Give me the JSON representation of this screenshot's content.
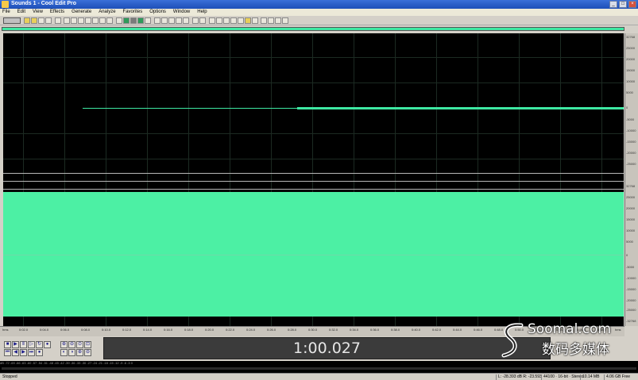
{
  "window": {
    "title": "Sounds 1 - Cool Edit Pro",
    "controls": [
      "_",
      "□",
      "×"
    ]
  },
  "menu": [
    "File",
    "Edit",
    "View",
    "Effects",
    "Generate",
    "Analyze",
    "Favorites",
    "Options",
    "Window",
    "Help"
  ],
  "time_display": "1:00.027",
  "amplitude_ruler": [
    "32768",
    "25000",
    "20000",
    "15000",
    "10000",
    "5000",
    "0",
    "-5000",
    "-10000",
    "-15000",
    "-20000",
    "-25000",
    "32768",
    "25000",
    "20000",
    "15000",
    "10000",
    "5000",
    "0",
    "-5000",
    "-10000",
    "-15000",
    "-20000",
    "-25000",
    "-32768"
  ],
  "time_ruler": [
    "hms",
    "0:02.0",
    "0:04.0",
    "0:06.0",
    "0:08.0",
    "0:10.0",
    "0:12.0",
    "0:14.0",
    "0:16.0",
    "0:18.0",
    "0:20.0",
    "0:22.0",
    "0:24.0",
    "0:26.0",
    "0:28.0",
    "0:30.0",
    "0:32.0",
    "0:34.0",
    "0:36.0",
    "0:38.0",
    "0:40.0",
    "0:42.0",
    "0:44.0",
    "0:46.0",
    "0:48.0",
    "0:50.0",
    "0:52.0",
    "0:54.0",
    "0:56.0",
    "0:58.0",
    "hms"
  ],
  "level_meter_scale": "dB -72 -69 -66 -63 -60 -57 -54 -51 -48 -45 -42 -39 -36 -33 -30 -27 -24 -21 -18 -15 -12 -9 -6 -3 0",
  "status": {
    "state": "Stopped",
    "selection": "L: -28.393 dB  R: -23.593",
    "format": "44100 · 16-bit · Stereo",
    "size": "10.14 MB",
    "free": "4.06 GB Free"
  },
  "watermark": {
    "brand": "Soomal.com",
    "subtitle": "数码多媒体"
  },
  "colors": {
    "waveform": "#4cf0a4",
    "background": "#000000",
    "chrome": "#d4d0c8",
    "titlebar": "#2456c6"
  }
}
